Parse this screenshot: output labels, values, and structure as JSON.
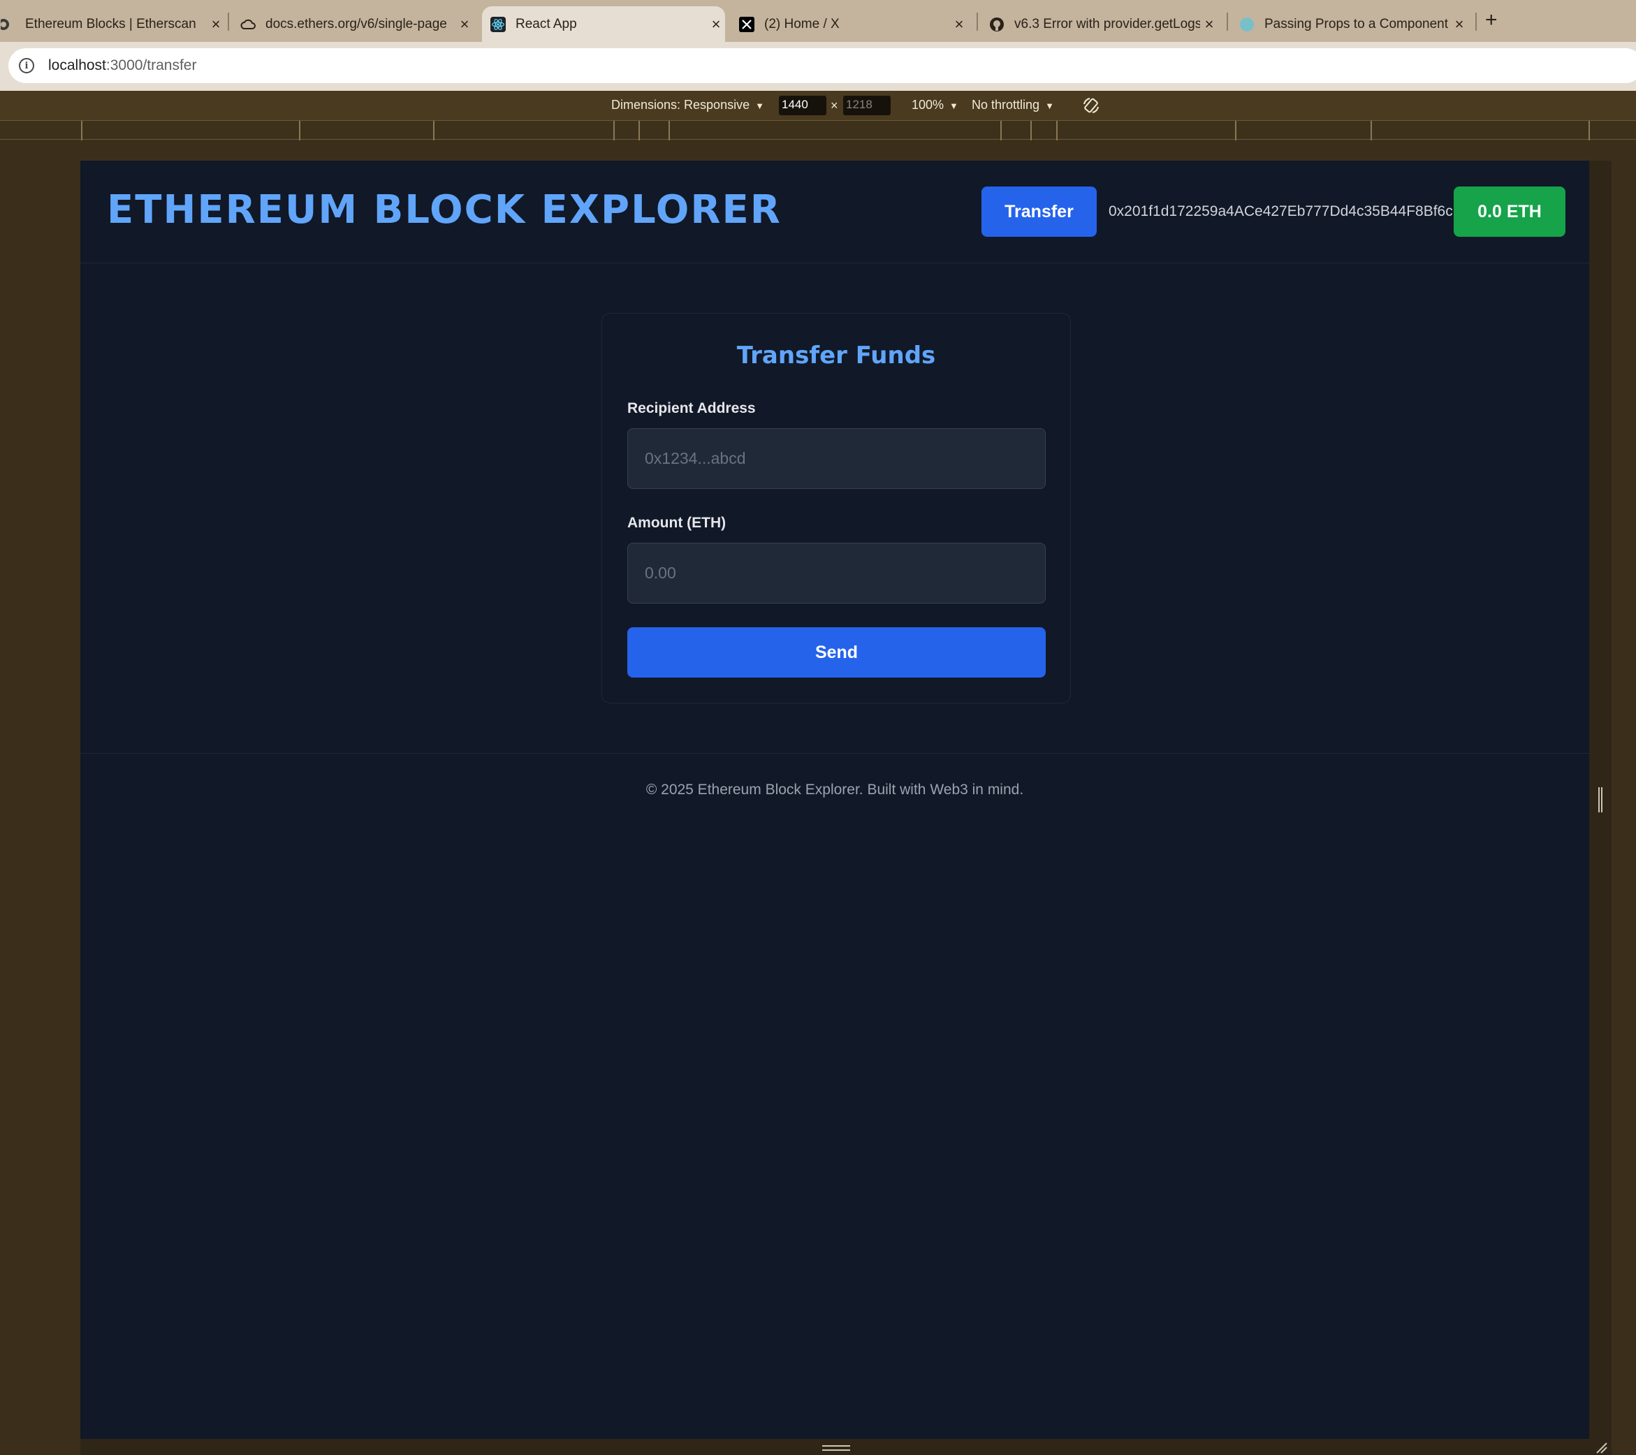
{
  "browser": {
    "tabs": [
      {
        "title": "Ethereum Blocks | Etherscan",
        "icon": "etherscan-icon",
        "active": false
      },
      {
        "title": "docs.ethers.org/v6/single-page",
        "icon": "cloud-icon",
        "active": false
      },
      {
        "title": "React App",
        "icon": "react-icon",
        "active": true
      },
      {
        "title": "(2) Home / X",
        "icon": "x-logo-icon",
        "active": false
      },
      {
        "title": "v6.3 Error with provider.getLogs",
        "icon": "github-icon",
        "active": false
      },
      {
        "title": "Passing Props to a Component",
        "icon": "react-docs-icon",
        "active": false
      }
    ],
    "new_tab": "+",
    "close_glyph": "×",
    "address": {
      "host": "localhost",
      "path": ":3000/transfer"
    }
  },
  "devtools": {
    "dimensions": "Dimensions: Responsive",
    "width": "1440",
    "times": "×",
    "height": "1218",
    "zoom": "100%",
    "throttling": "No throttling"
  },
  "app": {
    "brand": "ETHEREUM BLOCK EXPLORER",
    "transfer_button": "Transfer",
    "wallet_address": "0x201f1d172259a4ACe427Eb777Dd4c35B44F8Bf6c",
    "balance": "0.0 ETH",
    "form": {
      "title": "Transfer Funds",
      "recipient_label": "Recipient Address",
      "recipient_placeholder": "0x1234...abcd",
      "amount_label": "Amount (ETH)",
      "amount_placeholder": "0.00",
      "send_button": "Send"
    },
    "footer": "© 2025 Ethereum Block Explorer. Built with Web3 in mind."
  },
  "colors": {
    "page_bg": "#111827",
    "accent_blue": "#60a5fa",
    "primary_button": "#2563eb",
    "balance_green": "#16a34a"
  }
}
